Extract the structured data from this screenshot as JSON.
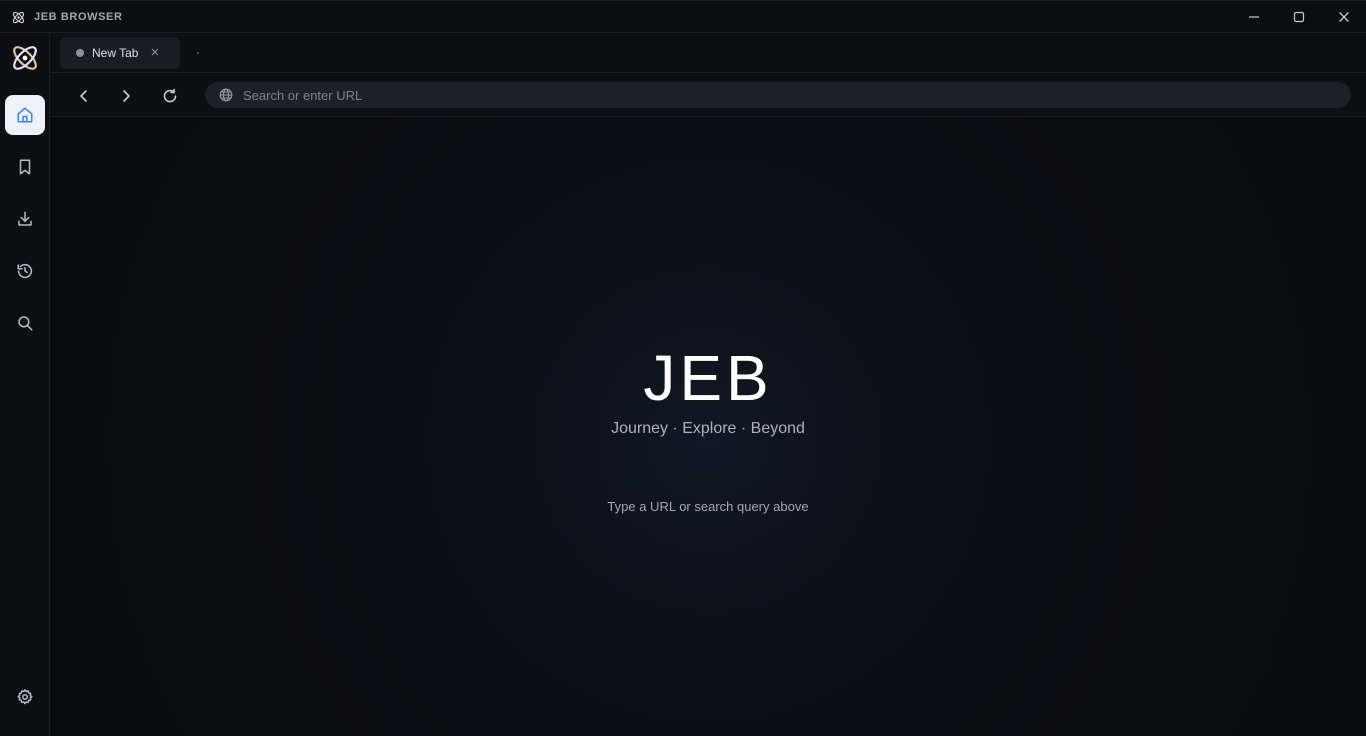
{
  "window": {
    "title": "JEB BROWSER",
    "controls": {
      "minimize": "minimize-icon",
      "maximize": "maximize-icon",
      "close": "close-icon"
    }
  },
  "sidebar": {
    "items": [
      {
        "name": "home",
        "icon": "home-icon",
        "active": true
      },
      {
        "name": "bookmarks",
        "icon": "bookmark-icon",
        "active": false
      },
      {
        "name": "downloads",
        "icon": "download-icon",
        "active": false
      },
      {
        "name": "history",
        "icon": "history-icon",
        "active": false
      },
      {
        "name": "search",
        "icon": "search-icon",
        "active": false
      }
    ],
    "settings_icon": "gear-icon"
  },
  "tabs": [
    {
      "label": "New Tab",
      "active": true
    }
  ],
  "navbar": {
    "url_placeholder": "Search or enter URL",
    "url_value": ""
  },
  "main": {
    "brand": "JEB",
    "tagline": "Journey · Explore · Beyond",
    "hint": "Type a URL or search query above"
  },
  "colors": {
    "accent": "#3b82f6",
    "background": "#0b0c10",
    "active_sidebar_bg": "#eef1f8"
  }
}
